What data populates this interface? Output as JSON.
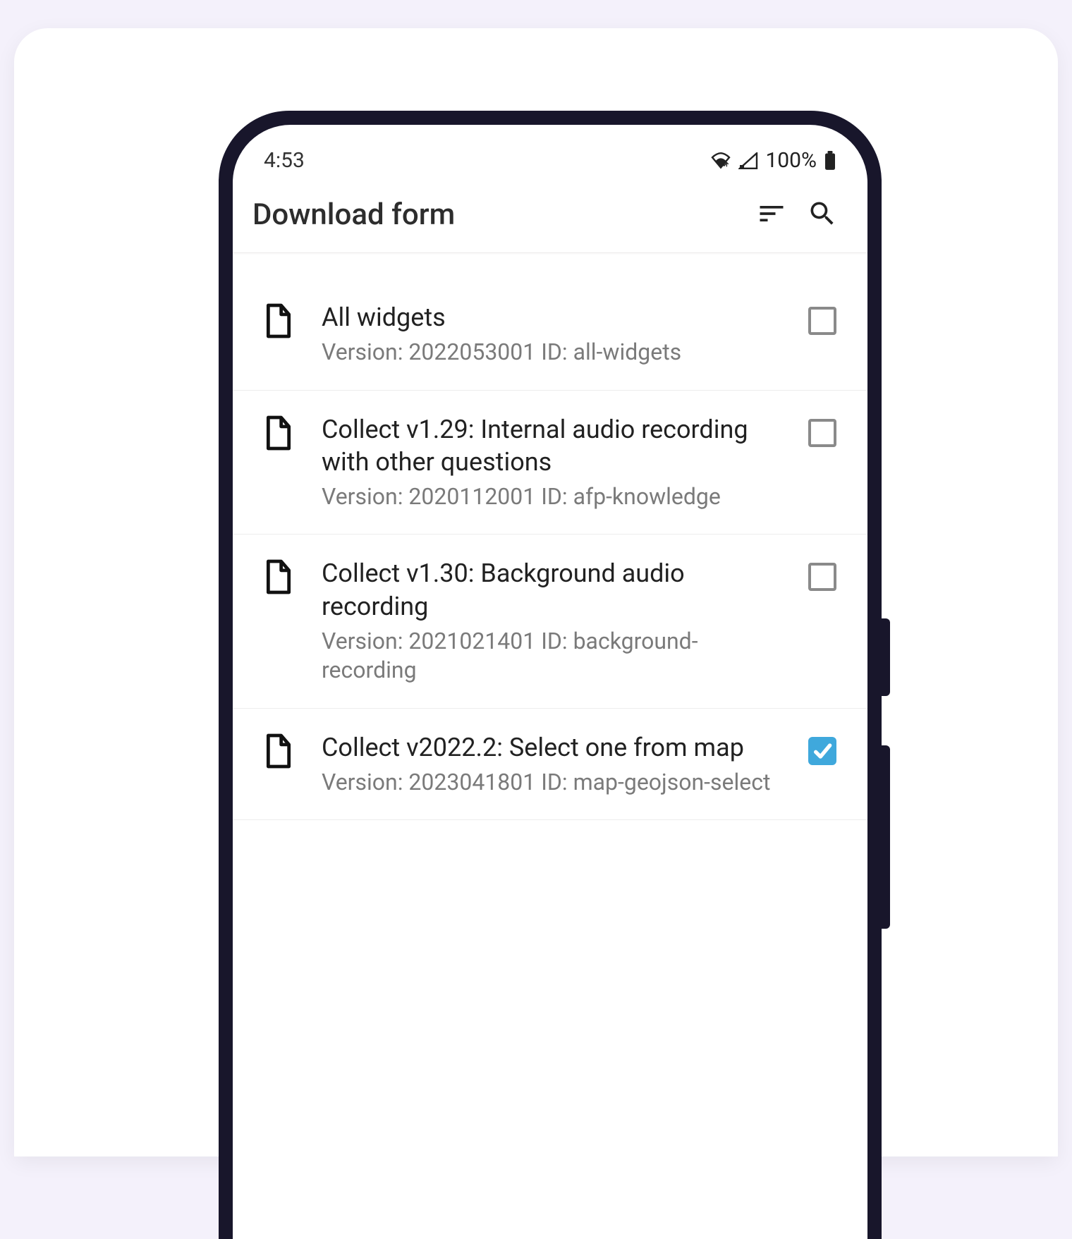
{
  "statusbar": {
    "time": "4:53",
    "battery_text": "100%"
  },
  "appbar": {
    "title": "Download form"
  },
  "forms": [
    {
      "title": "All widgets",
      "sub": "Version: 2022053001 ID: all-widgets",
      "checked": false
    },
    {
      "title": "Collect v1.29: Internal audio recording with other questions",
      "sub": "Version: 2020112001 ID: afp-knowledge",
      "checked": false
    },
    {
      "title": "Collect v1.30: Background audio recording",
      "sub": "Version: 2021021401 ID: background-recording",
      "checked": false
    },
    {
      "title": "Collect v2022.2: Select one from map",
      "sub": "Version: 2023041801 ID: map-geojson-select",
      "checked": true
    }
  ]
}
